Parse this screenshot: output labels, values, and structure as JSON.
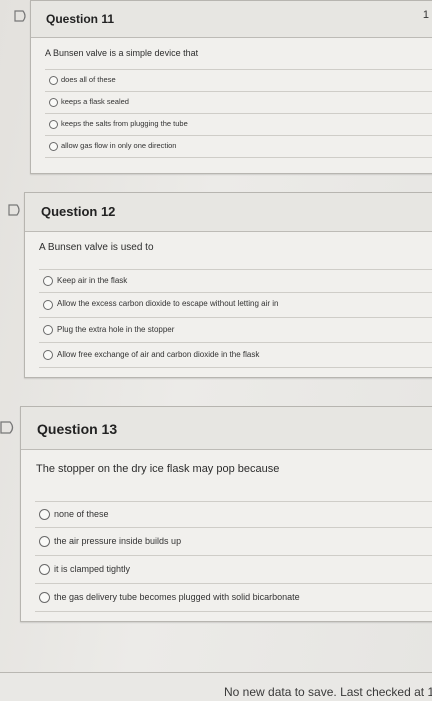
{
  "questions": [
    {
      "title": "Question 11",
      "points": "1",
      "prompt": "A Bunsen valve is a simple device that",
      "options": [
        "does all of these",
        "keeps a flask sealed",
        "keeps the salts from plugging the tube",
        "allow gas flow in only one direction"
      ]
    },
    {
      "title": "Question 12",
      "prompt": "A Bunsen valve is used to",
      "options": [
        "Keep air in the flask",
        "Allow the excess carbon dioxide to escape without letting air in",
        "Plug the extra hole in the stopper",
        "Allow free exchange of air and carbon dioxide in the flask"
      ]
    },
    {
      "title": "Question 13",
      "prompt": "The stopper on the dry ice flask may pop because",
      "options": [
        "none of these",
        "the air pressure inside builds up",
        "it is clamped tightly",
        "the gas delivery tube becomes plugged with solid bicarbonate"
      ]
    }
  ],
  "footer": {
    "status": "No new data to save. Last checked at 1"
  }
}
